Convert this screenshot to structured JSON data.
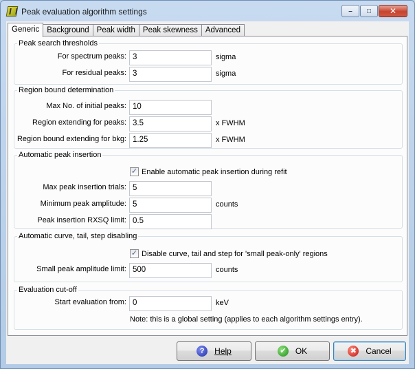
{
  "window": {
    "title": "Peak evaluation algorithm settings",
    "minimize_glyph": "–",
    "maximize_glyph": "□",
    "close_glyph": "✕"
  },
  "tabs": [
    {
      "label": "Generic",
      "active": true
    },
    {
      "label": "Background",
      "active": false
    },
    {
      "label": "Peak width",
      "active": false
    },
    {
      "label": "Peak skewness",
      "active": false
    },
    {
      "label": "Advanced",
      "active": false
    }
  ],
  "peak_search": {
    "legend": "Peak search thresholds",
    "spectrum_label": "For spectrum peaks:",
    "spectrum_value": "3",
    "spectrum_unit": "sigma",
    "residual_label": "For residual peaks:",
    "residual_value": "3",
    "residual_unit": "sigma"
  },
  "region_bound": {
    "legend": "Region bound determination",
    "max_initial_label": "Max No. of initial peaks:",
    "max_initial_value": "10",
    "extend_peaks_label": "Region extending for peaks:",
    "extend_peaks_value": "3.5",
    "extend_peaks_unit": "x  FWHM",
    "extend_bkg_label": "Region bound extending for bkg:",
    "extend_bkg_value": "1.25",
    "extend_bkg_unit": "x  FWHM"
  },
  "auto_insertion": {
    "legend": "Automatic peak insertion",
    "enable_label": "Enable automatic peak insertion during refit",
    "enable_checked": "✓",
    "max_trials_label": "Max peak insertion trials:",
    "max_trials_value": "5",
    "min_amp_label": "Minimum peak amplitude:",
    "min_amp_value": "5",
    "min_amp_unit": "counts",
    "rxsq_label": "Peak insertion RXSQ limit:",
    "rxsq_value": "0.5"
  },
  "auto_disable": {
    "legend": "Automatic curve, tail, step disabling",
    "disable_label": "Disable curve, tail and step for 'small peak-only' regions",
    "disable_checked": "✓",
    "small_amp_label": "Small peak amplitude limit:",
    "small_amp_value": "500",
    "small_amp_unit": "counts"
  },
  "cutoff": {
    "legend": "Evaluation cut-off",
    "start_label": "Start evaluation from:",
    "start_value": "0",
    "start_unit": "keV",
    "note": "Note: this is a global setting (applies to each algorithm settings entry)."
  },
  "buttons": {
    "help_label": "Help",
    "ok_label": "OK",
    "cancel_label": "Cancel",
    "help_glyph": "?",
    "ok_glyph": "✔",
    "cancel_glyph": "✖"
  }
}
